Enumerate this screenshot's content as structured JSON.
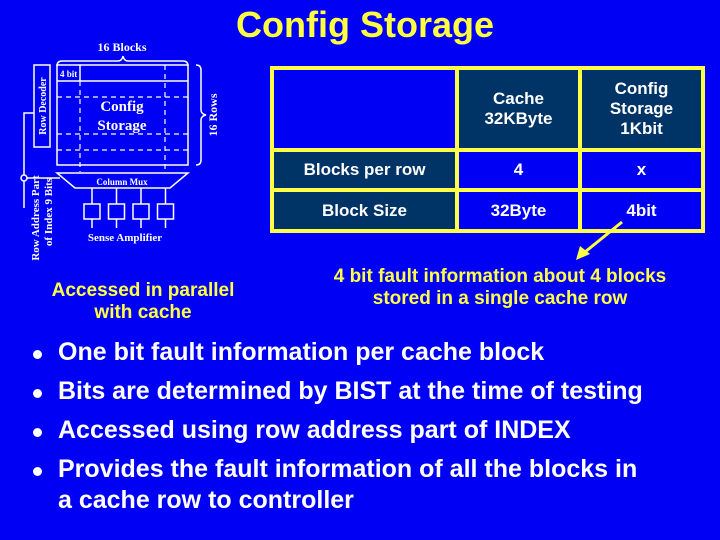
{
  "slide": {
    "title": "Config Storage",
    "colors": {
      "background": "#0000f5",
      "title": "#ffff40",
      "table_border": "#ffff48",
      "table_header_cell": "#003366",
      "text": "#ffffff",
      "note": "#ffff48"
    }
  },
  "diagram": {
    "top_label": "16 Blocks",
    "cell_label": "4 bit",
    "array_label_line1": "Config",
    "array_label_line2": "Storage",
    "side_label": "16 Rows",
    "decoder_label": "Row Decoder",
    "mux_label": "Column Mux",
    "sense_label": "Sense Amplifier",
    "address_label_line1": "Row Address Part",
    "address_label_line2": "of Index 9 Bits",
    "sense_amp_count": 4
  },
  "table": {
    "header": [
      "",
      "Cache 32KByte",
      "Config Storage 1Kbit"
    ],
    "header_lines": {
      "cache": [
        "Cache",
        "32KByte"
      ],
      "config": [
        "Config",
        "Storage",
        "1Kbit"
      ]
    },
    "rows": [
      {
        "label": "Blocks per row",
        "cache": "4",
        "config": "x"
      },
      {
        "label": "Block Size",
        "cache": "32Byte",
        "config": "4bit"
      }
    ]
  },
  "notes": {
    "parallel_line1": "Accessed in parallel",
    "parallel_line2": "with cache",
    "fault_line1": "4 bit fault information about 4 blocks",
    "fault_line2": "stored in a single cache row"
  },
  "bullets": [
    {
      "text": "One bit fault information per cache block"
    },
    {
      "text": "Bits are determined by BIST at the time of testing"
    },
    {
      "text": "Accessed using row address part of INDEX"
    },
    {
      "line1": "Provides the fault information of all the blocks in",
      "line2": "a cache row to controller"
    }
  ]
}
